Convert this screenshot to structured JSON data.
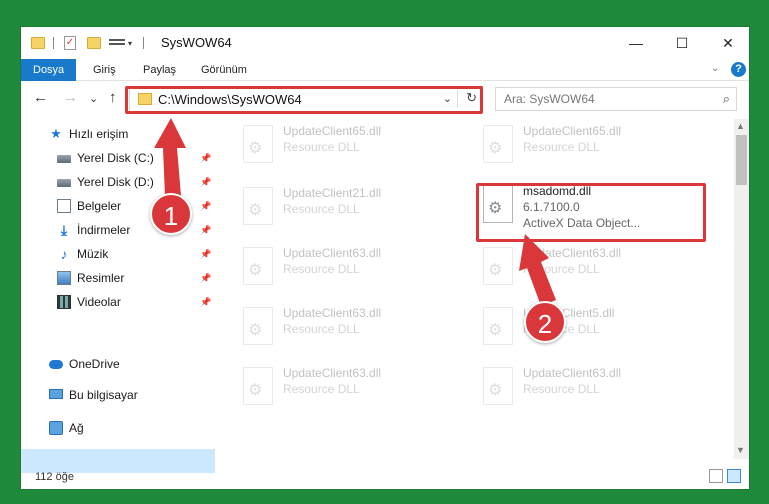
{
  "window": {
    "title": "SysWOW64",
    "controls": {
      "minimize": "—",
      "maximize": "☐",
      "close": "✕"
    }
  },
  "quick_access_toolbar": {
    "dropdown": "▾"
  },
  "ribbon": {
    "tabs": [
      "Dosya",
      "Giriş",
      "Paylaş",
      "Görünüm"
    ],
    "collapse": "⌄",
    "help": "?"
  },
  "address_bar": {
    "path": "C:\\Windows\\SysWOW64",
    "dropdown": "⌄",
    "refresh": "↻"
  },
  "nav_buttons": {
    "back": "←",
    "forward": "→",
    "recent": "⌄",
    "up": "↑"
  },
  "search": {
    "placeholder": "Ara: SysWOW64",
    "icon": "⌕"
  },
  "nav_pane": {
    "items": [
      {
        "label": "Hızlı erişim",
        "icon": "star-icon"
      },
      {
        "label": "Yerel Disk (C:)",
        "icon": "disk-icon",
        "pinned": true
      },
      {
        "label": "Yerel Disk (D:)",
        "icon": "disk-icon",
        "pinned": true
      },
      {
        "label": "Belgeler",
        "icon": "documents-icon",
        "pinned": true
      },
      {
        "label": "İndirmeler",
        "icon": "downloads-icon",
        "pinned": true
      },
      {
        "label": "Müzik",
        "icon": "music-icon",
        "pinned": true
      },
      {
        "label": "Resimler",
        "icon": "pictures-icon",
        "pinned": true
      },
      {
        "label": "Videolar",
        "icon": "videos-icon",
        "pinned": true
      },
      {
        "label": "OneDrive",
        "icon": "onedrive-icon"
      },
      {
        "label": "Bu bilgisayar",
        "icon": "pc-icon",
        "selected": true
      },
      {
        "label": "Ağ",
        "icon": "network-icon"
      }
    ],
    "pin_glyph": "📌"
  },
  "files": [
    {
      "name": "UpdateClient65.dll",
      "line2": "Resource DLL"
    },
    {
      "name": "UpdateClient65.dll",
      "line2": "Resource DLL"
    },
    {
      "name": "UpdateClient21.dll",
      "line2": "Resource DLL"
    },
    {
      "name": "msadomd.dll",
      "line2": "6.1.7100.0",
      "line3": "ActiveX Data Object...",
      "highlighted": true
    },
    {
      "name": "UpdateClient63.dll",
      "line2": "Resource DLL"
    },
    {
      "name": "UpdateClient63.dll",
      "line2": "Resource DLL"
    },
    {
      "name": "UpdateClient63.dll",
      "line2": "Resource DLL"
    },
    {
      "name": "UpdateClient5.dll",
      "line2": "Resource DLL"
    },
    {
      "name": "UpdateClient63.dll",
      "line2": "Resource DLL"
    },
    {
      "name": "UpdateClient63.dll",
      "line2": "Resource DLL"
    }
  ],
  "status_bar": {
    "item_count": "112 öğe"
  },
  "scrollbar": {
    "up": "▲",
    "down": "▼"
  },
  "annotations": {
    "step1": "1",
    "step2": "2",
    "color": "#d9373a"
  },
  "colors": {
    "accent": "#1979ca",
    "background": "#1f8a3b",
    "selection": "#cce8ff"
  }
}
